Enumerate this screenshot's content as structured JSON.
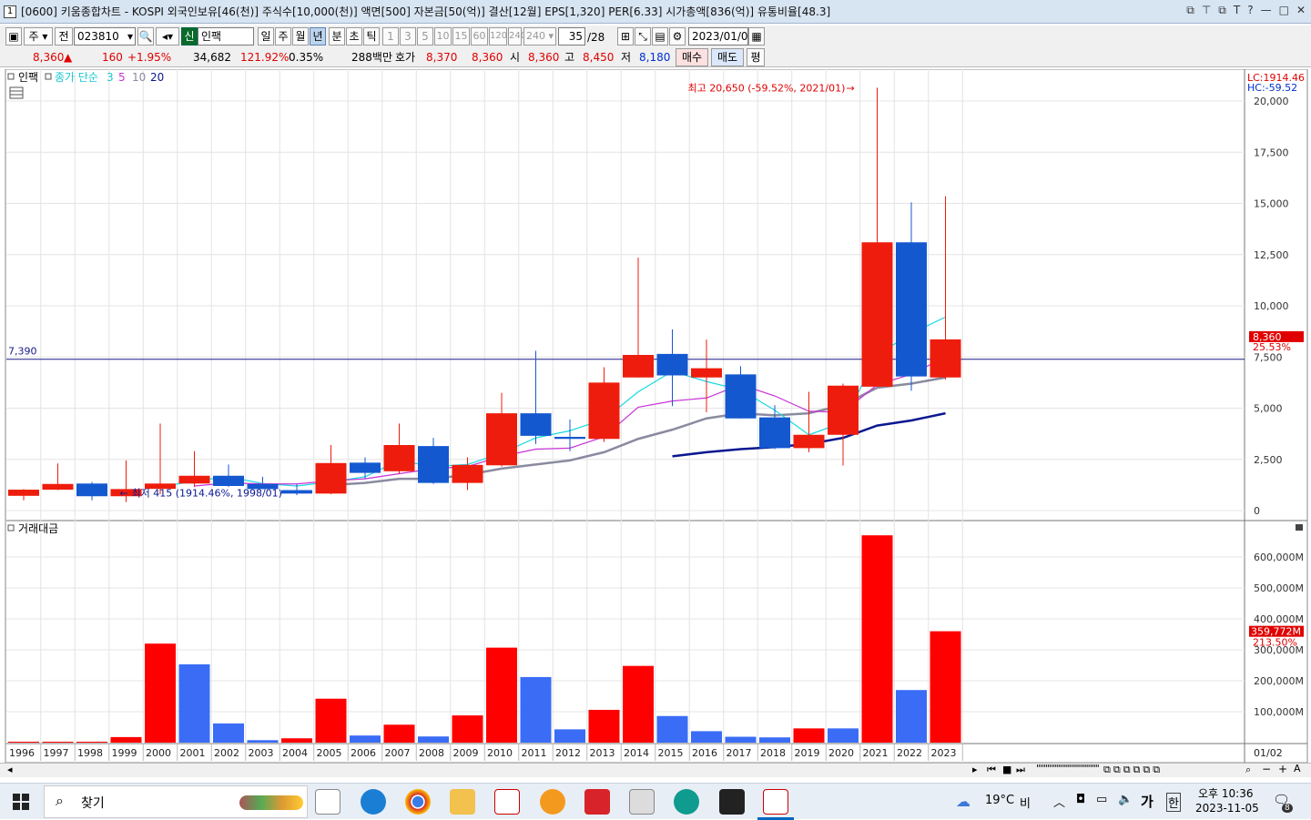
{
  "window": {
    "number": "1",
    "title": "[0600] 키움종합차트 - KOSPI 외국인보유[46(천)] 주식수[10,000(천)] 액면[500] 자본금[50(억)] 결산[12월] EPS[1,320] PER[6.33] 시가총액[836(억)] 유통비율[48.3]"
  },
  "toolbar": {
    "market_type": "주",
    "scope": "전",
    "code": "023810",
    "credit_badge": "신",
    "stock_name": "인팩",
    "periods": [
      "일",
      "주",
      "월",
      "년",
      "분",
      "초",
      "틱"
    ],
    "selected_period": "년",
    "intervals": [
      "1",
      "3",
      "5",
      "10",
      "15",
      "60",
      "120",
      "240"
    ],
    "interval_select": "240",
    "count": "35",
    "count_total": "/28",
    "date": "2023/01/02"
  },
  "quote": {
    "price": "8,360",
    "arrow": "▲",
    "change": "160",
    "change_pct": "+1.95%",
    "volume": "34,682",
    "volume_ratio": "121.92%",
    "turnover": "0.35%",
    "amount": "288백만",
    "bid_label": "호가",
    "bid1": "8,370",
    "bid2": "8,360",
    "open_label": "시",
    "open": "8,360",
    "high_label": "고",
    "high": "8,450",
    "low_label": "저",
    "low": "8,180",
    "buy_btn": "매수",
    "sell_btn": "매도",
    "avg_btn": "평"
  },
  "legend": {
    "stock": "인팩",
    "ma_label": "종가 단순",
    "ma3": "3",
    "ma5": "5",
    "ma10": "10",
    "ma20": "20",
    "volume_panel": "거래대금"
  },
  "colors": {
    "up": "#ee1c0c",
    "down": "#1458d0",
    "ma3": "#18d8e0",
    "ma5": "#c832d8",
    "ma10": "#8a8aa0",
    "ma20": "#0a1890",
    "vol_up": "#ff0000",
    "vol_down": "#3a6cf6"
  },
  "chart_data": [
    {
      "type": "candlestick",
      "title": "인팩 년봉",
      "x": [
        "1996",
        "1997",
        "1998",
        "1999",
        "2000",
        "2001",
        "2002",
        "2003",
        "2004",
        "2005",
        "2006",
        "2007",
        "2008",
        "2009",
        "2010",
        "2011",
        "2012",
        "2013",
        "2014",
        "2015",
        "2016",
        "2017",
        "2018",
        "2019",
        "2020",
        "2021",
        "2022",
        "2023"
      ],
      "ohlc": [
        [
          720,
          1050,
          500,
          1020
        ],
        [
          1020,
          2300,
          1000,
          1300
        ],
        [
          1320,
          1400,
          500,
          700
        ],
        [
          700,
          2450,
          415,
          1050
        ],
        [
          1060,
          4250,
          800,
          1320
        ],
        [
          1320,
          2900,
          1150,
          1700
        ],
        [
          1700,
          2250,
          1150,
          1200
        ],
        [
          1300,
          1650,
          1050,
          1050
        ],
        [
          1000,
          1300,
          750,
          830
        ],
        [
          830,
          3200,
          800,
          2320
        ],
        [
          2340,
          2600,
          1550,
          1840
        ],
        [
          1920,
          4250,
          1800,
          3200
        ],
        [
          3150,
          3550,
          1300,
          1350
        ],
        [
          1350,
          2600,
          1000,
          2230
        ],
        [
          2210,
          5750,
          2150,
          4750
        ],
        [
          4750,
          7800,
          3250,
          3650
        ],
        [
          3600,
          4450,
          2900,
          3500
        ],
        [
          3500,
          7000,
          3350,
          6250
        ],
        [
          6500,
          12350,
          6500,
          7600
        ],
        [
          7650,
          8850,
          5100,
          6600
        ],
        [
          6500,
          8350,
          4800,
          6950
        ],
        [
          6650,
          7050,
          4500,
          4500
        ],
        [
          4550,
          5150,
          3000,
          3050
        ],
        [
          3050,
          5800,
          2850,
          3700
        ],
        [
          3700,
          6200,
          2200,
          6100
        ],
        [
          6050,
          20650,
          6050,
          13100
        ],
        [
          13100,
          15050,
          5850,
          6550
        ],
        [
          6500,
          15350,
          6400,
          8360
        ]
      ],
      "ma3": [
        null,
        null,
        null,
        null,
        1150,
        1450,
        1650,
        1320,
        1200,
        1400,
        1650,
        2450,
        2150,
        2250,
        2800,
        3550,
        3900,
        4450,
        5800,
        6800,
        6300,
        5900,
        4900,
        3700,
        4300,
        7600,
        8650,
        9450
      ],
      "ma5": [
        null,
        null,
        null,
        null,
        null,
        1200,
        1350,
        1300,
        1300,
        1450,
        1550,
        1800,
        2050,
        2150,
        2650,
        3000,
        3050,
        3600,
        5050,
        5350,
        5500,
        6150,
        5600,
        4850,
        4800,
        6150,
        6650,
        7500
      ],
      "ma10": [
        null,
        null,
        null,
        null,
        null,
        null,
        null,
        null,
        null,
        1250,
        1350,
        1550,
        1550,
        1750,
        2050,
        2250,
        2450,
        2850,
        3500,
        3950,
        4500,
        4750,
        4650,
        4750,
        5150,
        6000,
        6200,
        6500
      ],
      "ma20": [
        null,
        null,
        null,
        null,
        null,
        null,
        null,
        null,
        null,
        null,
        null,
        null,
        null,
        null,
        null,
        null,
        null,
        null,
        null,
        2650,
        2850,
        3000,
        3100,
        3250,
        3550,
        4150,
        4400,
        4750
      ],
      "ylim": [
        0,
        21000
      ],
      "yticks": [
        "0",
        "2,500",
        "5,000",
        "7,500",
        "10,000",
        "12,500",
        "15,000",
        "17,500",
        "20,000"
      ],
      "ytick_values": [
        0,
        2500,
        5000,
        7500,
        10000,
        12500,
        15000,
        17500,
        20000
      ],
      "hline_value": 7390,
      "hline_label": "7,390",
      "high_annotation": "최고 20,650 (-59.52%, 2021/01)",
      "low_annotation": "최저 415 (1914.46%, 1998/01)",
      "lc_label": "LC:1914.46",
      "hc_label": "HC:-59.52",
      "current_price": "8,360",
      "current_pct": "25.53%"
    },
    {
      "type": "bar",
      "title": "거래대금",
      "x": [
        "1996",
        "1997",
        "1998",
        "1999",
        "2000",
        "2001",
        "2002",
        "2003",
        "2004",
        "2005",
        "2006",
        "2007",
        "2008",
        "2009",
        "2010",
        "2011",
        "2012",
        "2013",
        "2014",
        "2015",
        "2016",
        "2017",
        "2018",
        "2019",
        "2020",
        "2021",
        "2022",
        "2023"
      ],
      "values": [
        3,
        3,
        3,
        18,
        320,
        253,
        62,
        8,
        14,
        142,
        23,
        58,
        20,
        88,
        307,
        212,
        43,
        106,
        248,
        86,
        37,
        19,
        17,
        46,
        46,
        670,
        170,
        360
      ],
      "up": [
        true,
        true,
        true,
        true,
        true,
        false,
        false,
        false,
        true,
        true,
        false,
        true,
        false,
        true,
        true,
        false,
        false,
        true,
        true,
        false,
        false,
        false,
        false,
        true,
        false,
        true,
        false,
        true
      ],
      "unit": "M",
      "ylim": [
        0,
        700
      ],
      "yticks": [
        "100,000M",
        "200,000M",
        "300,000M",
        "400,000M",
        "500,000M",
        "600,000M"
      ],
      "ytick_values": [
        100,
        200,
        300,
        400,
        500,
        600
      ],
      "current_value": "359,772M",
      "current_pct": "213.50%",
      "x_end_label": "01/02"
    }
  ],
  "taskbar": {
    "search": "찾기",
    "weather_temp": "19°C",
    "weather_text": "비",
    "ime_a": "가",
    "ime_b": "한",
    "time": "오후 10:36",
    "date": "2023-11-05",
    "notif_count": "8"
  }
}
